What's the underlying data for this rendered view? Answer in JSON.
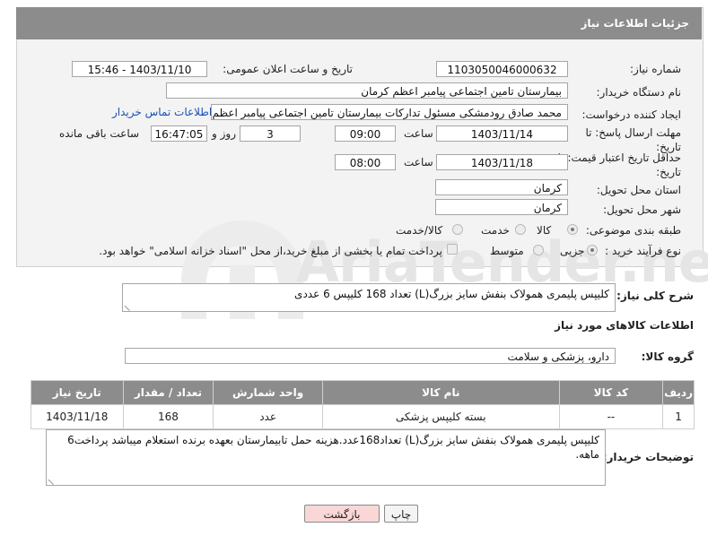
{
  "header": {
    "title": "جزئیات اطلاعات نیاز"
  },
  "form": {
    "need_number_label": "شماره نیاز:",
    "need_number": "1103050046000632",
    "announce_label": "تاریخ و ساعت اعلان عمومی:",
    "announce_value": "1403/11/10 - 15:46",
    "buyer_org_label": "نام دستگاه خریدار:",
    "buyer_org": "بیمارستان تامین اجتماعی پیامبر اعظم کرمان",
    "creator_label": "ایجاد کننده درخواست:",
    "creator": "محمد صادق  رودمشکی مسئول تدارکات بیمارستان تامین اجتماعی پیامبر اعظم",
    "contact_link": "اطلاعات تماس خریدار",
    "deadline_label": "مهلت ارسال پاسخ: تا تاریخ:",
    "deadline_date": "1403/11/14",
    "time_label": "ساعت",
    "deadline_time": "09:00",
    "days_value": "3",
    "days_and_label": "روز و",
    "remaining_time": "16:47:05",
    "remaining_label": "ساعت باقی مانده",
    "price_validity_label": "حداقل تاریخ اعتبار قیمت: تا تاریخ:",
    "price_validity_date": "1403/11/18",
    "price_validity_time": "08:00",
    "province_label": "استان محل تحویل:",
    "province": "کرمان",
    "city_label": "شهر محل تحویل:",
    "city": "کرمان",
    "category_label": "طبقه بندی موضوعی:",
    "category_options": [
      "کالا",
      "خدمت",
      "کالا/خدمت"
    ],
    "purchase_type_label": "نوع فرآیند خرید :",
    "purchase_options": [
      "جزیی",
      "متوسط"
    ],
    "payment_note": "پرداخت تمام یا بخشی از مبلغ خرید،از محل \"اسناد خزانه اسلامی\" خواهد بود."
  },
  "summary": {
    "label": "شرح کلی نیاز:",
    "text": "کلیپس پلیمری همولاک بنفش سایز بزرگ(L) تعداد 168 کلیپس 6 عددی"
  },
  "goods_info": {
    "title": "اطلاعات کالاهای مورد نیاز",
    "group_label": "گروه کالا:",
    "group_value": "دارو، پزشکی و سلامت"
  },
  "table": {
    "headers": [
      "ردیف",
      "کد کالا",
      "نام کالا",
      "واحد شمارش",
      "تعداد / مقدار",
      "تاریخ نیاز"
    ],
    "rows": [
      [
        "1",
        "--",
        "بسته کلیپس پزشکی",
        "عدد",
        "168",
        "1403/11/18"
      ]
    ]
  },
  "buyer_notes": {
    "label": "توضیحات خریدار:",
    "text": "کلیپس پلیمری همولاک بنفش سایز بزرگ(L) تعداد168عدد.هزینه حمل تابیمارستان بعهده برنده استعلام میباشد پرداخت6 ماهه."
  },
  "buttons": {
    "print": "چاپ",
    "back": "بازگشت"
  },
  "watermark": {
    "text": "AriaTender.net"
  },
  "colors": {
    "header_bg": "#8c8c8c",
    "link": "#1a4fb5",
    "back_btn_bg": "#f9d7d7"
  }
}
